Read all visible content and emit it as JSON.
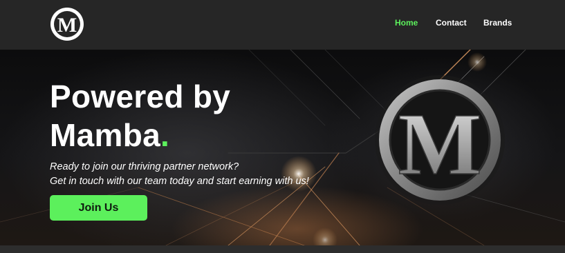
{
  "nav": {
    "logo_letter": "M",
    "items": [
      {
        "label": "Home",
        "active": true
      },
      {
        "label": "Contact",
        "active": false
      },
      {
        "label": "Brands",
        "active": false
      }
    ]
  },
  "hero": {
    "title_line1": "Powered by",
    "title_line2": "Mamba",
    "title_dot": ".",
    "subtitle_line1": "Ready to join our thriving partner network?",
    "subtitle_line2": "Get in touch with our team today and start earning with us!",
    "cta_label": "Join Us",
    "emblem_letter": "M"
  },
  "colors": {
    "accent": "#5cf05c",
    "nav_background": "#262626",
    "hero_background": "#111111",
    "text": "#ffffff"
  },
  "icons": {
    "logo": "m-circle-logo-icon",
    "emblem": "m-metal-emblem-icon"
  }
}
